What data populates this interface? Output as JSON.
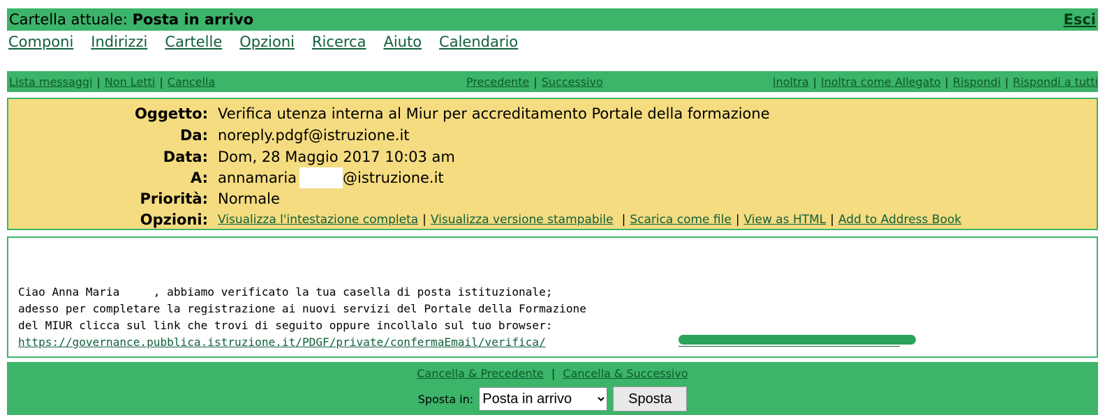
{
  "topbar": {
    "folder_prefix": "Cartella attuale: ",
    "folder_name": "Posta in arrivo",
    "logout": "Esci"
  },
  "menu": [
    "Componi",
    "Indirizzi",
    "Cartelle",
    "Opzioni",
    "Ricerca",
    "Aiuto",
    "Calendario"
  ],
  "toolbar": {
    "list": "Lista messaggi",
    "unread": "Non Letti",
    "delete": "Cancella",
    "previous": "Precedente",
    "next": "Successivo",
    "forward": "Inoltra",
    "forward_attach": "Inoltra come Allegato",
    "reply": "Rispondi",
    "reply_all": "Rispondi a tutti",
    "separator": "|"
  },
  "header": {
    "subject_label": "Oggetto:",
    "subject": "Verifica utenza interna al Miur per accreditamento Portale della formazione",
    "from_label": "Da:",
    "from": "noreply.pdgf@istruzione.it",
    "date_label": "Data:",
    "date": "Dom, 28 Maggio 2017 10:03 am",
    "to_label": "A:",
    "to_name": "annamaria",
    "to_domain": "@istruzione.it",
    "priority_label": "Priorità:",
    "priority": "Normale",
    "options_label": "Opzioni:",
    "options": {
      "full_header": "Visualizza l'intestazione completa",
      "printable": "Visualizza versione stampabile",
      "download": "Scarica come file",
      "html": "View as HTML",
      "address_book": "Add to Address Book"
    }
  },
  "body": {
    "text": "Ciao Anna Maria     , abbiamo verificato la tua casella di posta istituzionale;\nadesso per completare la registrazione ai nuovi servizi del Portale della Formazione\ndel MIUR clicca sul link che trovi di seguito oppure incollalo sul tuo browser:",
    "link": "https://governance.pubblica.istruzione.it/PDGF/private/confermaEmail/verifica/"
  },
  "footer": {
    "delete_prev": "Cancella & Precedente",
    "delete_next": "Cancella & Successivo",
    "move_label": "Sposta in:",
    "move_selected": "Posta in arrivo",
    "move_button": "Sposta"
  }
}
